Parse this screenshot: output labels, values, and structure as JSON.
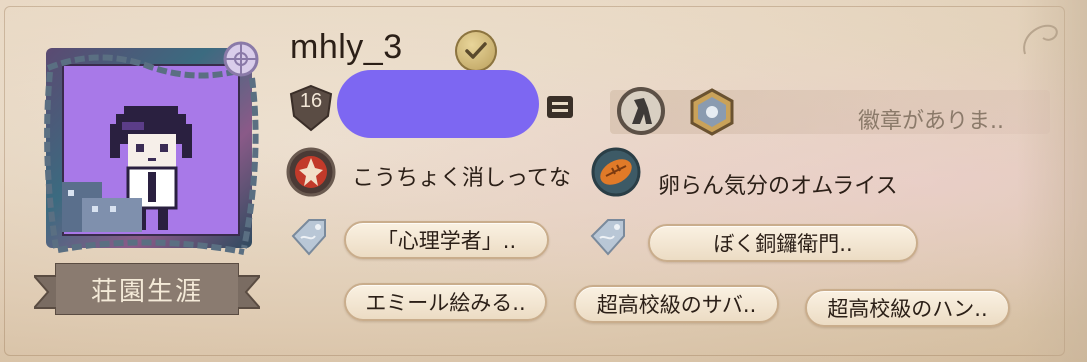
{
  "profile": {
    "username": "mhly_3",
    "level": "16",
    "title_banner": "荘園生涯",
    "badges_empty_text": "徽章がありま.."
  },
  "roles": [
    {
      "name": "こうちょく消しってな",
      "icon": "red-emblem-icon"
    },
    {
      "name": "卵らん気分のオムライス",
      "icon": "orange-rugby-ball-icon"
    }
  ],
  "tags": [
    {
      "label": "「心理学者」.."
    },
    {
      "label": "ぼく銅鑼衛門.."
    },
    {
      "label": "エミール絵みる.."
    },
    {
      "label": "超高校級のサバ.."
    },
    {
      "label": "超高校級のハン.."
    }
  ],
  "colors": {
    "redaction": "#7d67f2",
    "avatar_bg": "#a879e8",
    "pill_border": "#c9ad8c"
  }
}
